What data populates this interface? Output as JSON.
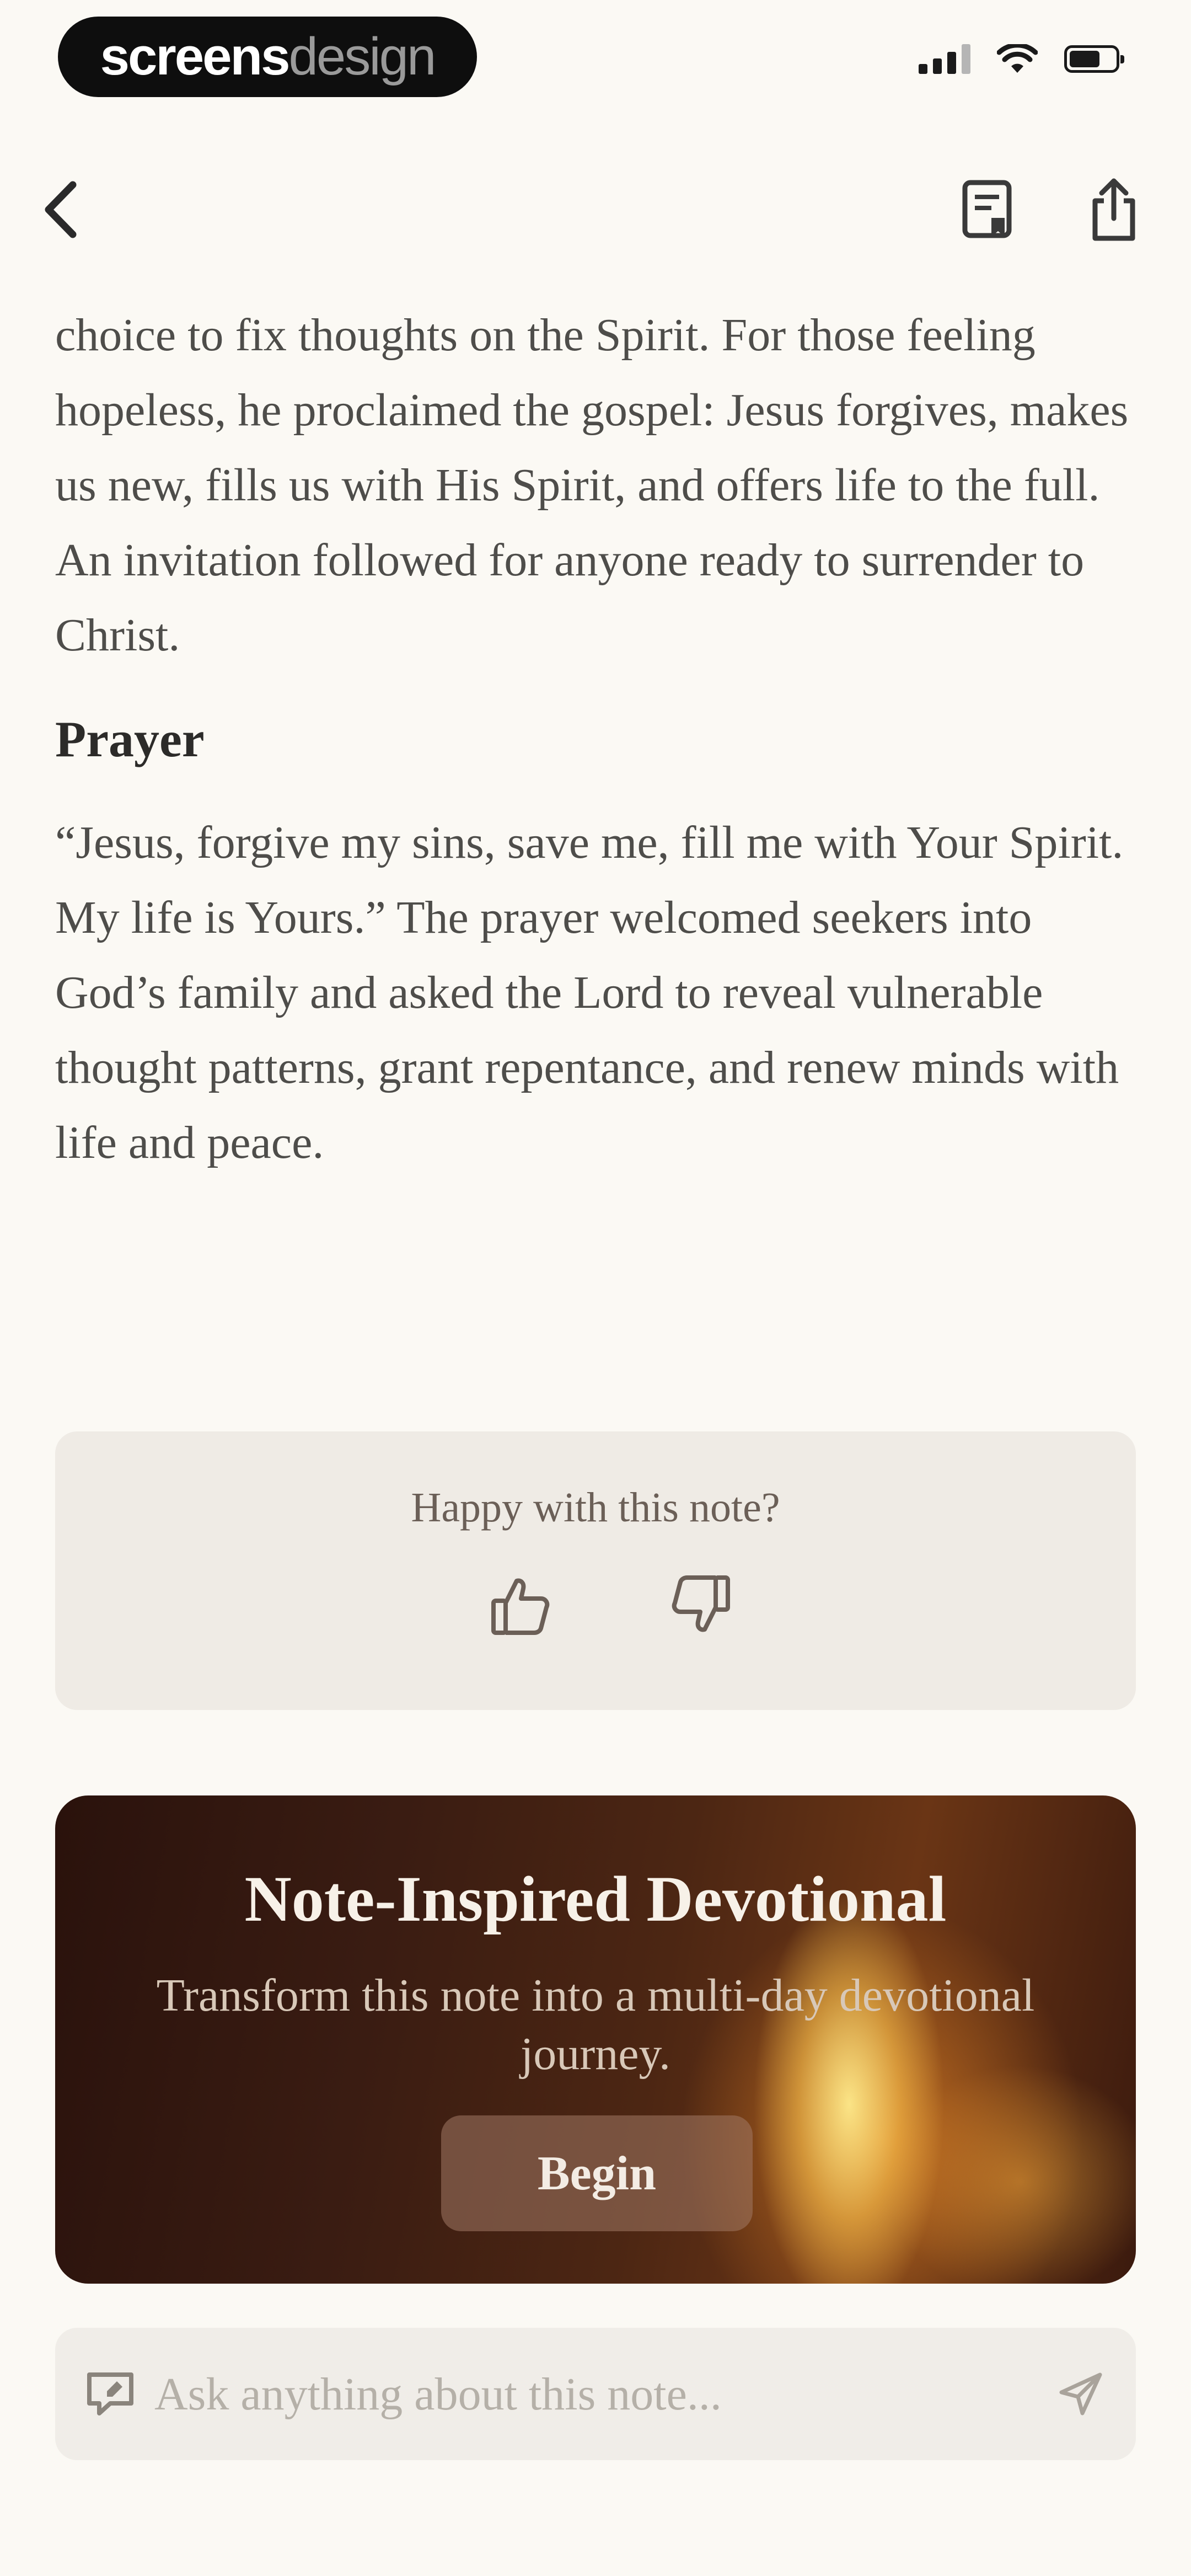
{
  "status_bar": {
    "brand_bold": "screens",
    "brand_light": "design"
  },
  "nav": {
    "back_icon": "chevron-left-icon",
    "save_icon": "bookmark-save-icon",
    "share_icon": "share-icon"
  },
  "note": {
    "intro_paragraph": "choice to fix thoughts on the Spirit. For those feeling hopeless, he proclaimed the gospel: Jesus forgives, makes us new, fills us with His Spirit, and offers life to the full. An invitation followed for anyone ready to surrender to Christ.",
    "prayer_heading": "Prayer",
    "prayer_paragraph": "“Jesus, forgive my sins, save me, fill me with Your Spirit. My life is Yours.” The prayer welcomed seekers into God’s family and asked the Lord to reveal vulnerable thought patterns, grant repentance, and renew minds with life and peace."
  },
  "feedback": {
    "question": "Happy with this note?",
    "like_icon": "thumbs-up-icon",
    "dislike_icon": "thumbs-down-icon"
  },
  "devotional": {
    "title": "Note-Inspired Devotional",
    "subtitle": "Transform this note into a multi-day devotional journey.",
    "button_label": "Begin"
  },
  "ask": {
    "placeholder": "Ask anything about this note...",
    "chat_icon": "chat-bubble-icon",
    "send_icon": "send-icon"
  },
  "colors": {
    "background": "#fbf9f4",
    "body_text": "#4e4d4a",
    "card_bg": "#efebe5",
    "devotional_dark": "#2a120c",
    "flame": "#f5c453"
  }
}
